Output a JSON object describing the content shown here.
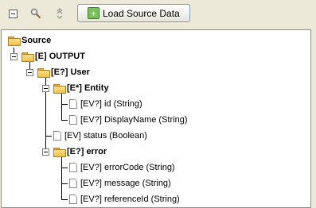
{
  "toolbar": {
    "load_label": "Load Source Data",
    "icons": [
      "collapse-icon",
      "search-icon",
      "expand-icon"
    ]
  },
  "tree": {
    "source": "Source",
    "output": "[E] OUTPUT",
    "user": "[E?] User",
    "entity": "[E*] Entity",
    "id": "[EV?] id (String)",
    "display_name": "[EV?] DisplayName (String)",
    "status": "[EV] status (Boolean)",
    "error": "[E?] error",
    "error_code": "[EV?] errorCode (String)",
    "message": "[EV?] message (String)",
    "reference_id": "[EV?] referenceId (String)"
  }
}
